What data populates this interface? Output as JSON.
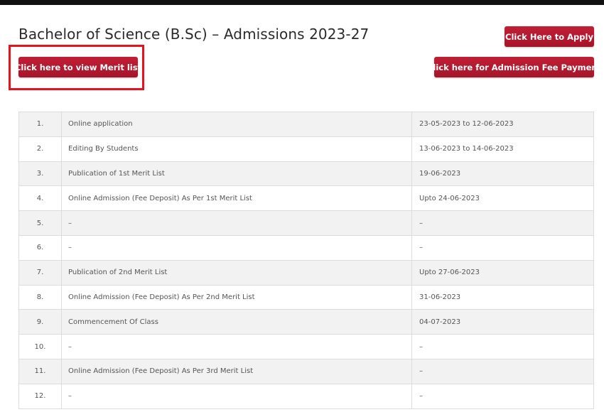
{
  "page": {
    "title": "Bachelor of Science (B.Sc) – Admissions 2023-27"
  },
  "buttons": {
    "apply": "Click Here to Apply",
    "merit_list": "Click here to view Merit list",
    "fee_payment": "Click here for Admission Fee Payment"
  },
  "colors": {
    "button": "#b01a2f",
    "highlight": "#e8111c",
    "row_alt": "#f2f2f2"
  },
  "schedule": {
    "rows": [
      {
        "num": "1.",
        "event": "Online application",
        "date": "23-05-2023 to 12-06-2023"
      },
      {
        "num": "2.",
        "event": "Editing By Students",
        "date": "13-06-2023 to 14-06-2023"
      },
      {
        "num": "3.",
        "event": "Publication of 1st Merit List",
        "date": "19-06-2023"
      },
      {
        "num": "4.",
        "event": "Online Admission (Fee Deposit) As Per 1st Merit List",
        "date": "Upto 24-06-2023"
      },
      {
        "num": "5.",
        "event": "–",
        "date": "–"
      },
      {
        "num": "6.",
        "event": "–",
        "date": "–"
      },
      {
        "num": "7.",
        "event": "Publication of 2nd Merit List",
        "date": "Upto 27-06-2023"
      },
      {
        "num": "8.",
        "event": "Online Admission (Fee Deposit) As Per 2nd Merit List",
        "date": "31-06-2023"
      },
      {
        "num": "9.",
        "event": "Commencement Of Class",
        "date": "04-07-2023"
      },
      {
        "num": "10.",
        "event": "–",
        "date": "–"
      },
      {
        "num": "11.",
        "event": "Online Admission (Fee Deposit) As Per 3rd Merit List",
        "date": "–"
      },
      {
        "num": "12.",
        "event": "–",
        "date": "–"
      }
    ]
  }
}
